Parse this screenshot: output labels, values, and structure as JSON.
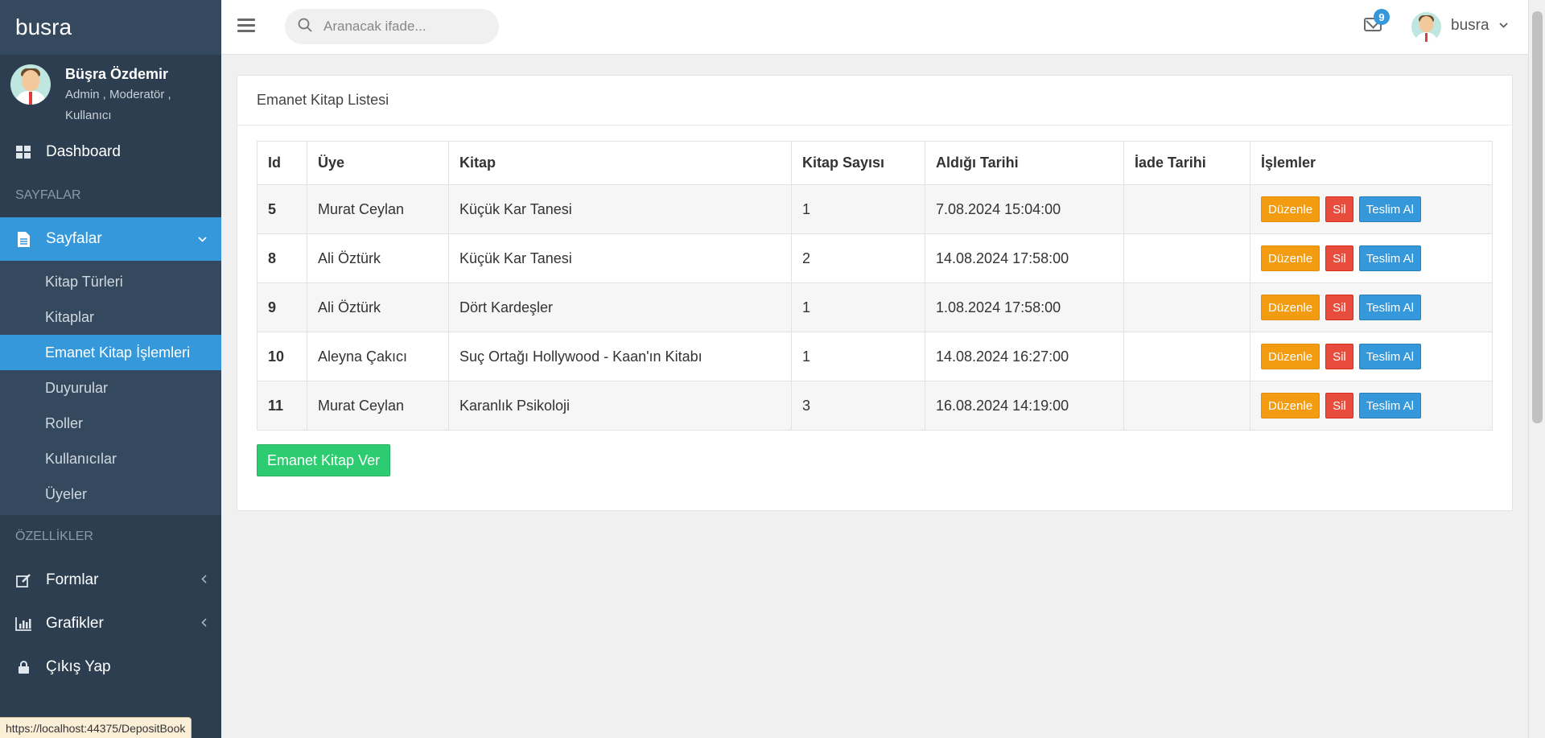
{
  "brand": "busra",
  "user": {
    "name": "Büşra Özdemir",
    "roles": "Admin , Moderatör , Kullanıcı"
  },
  "nav": {
    "dashboard": "Dashboard",
    "header_pages": "SAYFALAR",
    "pages": "Sayfalar",
    "sub_items": [
      "Kitap Türleri",
      "Kitaplar",
      "Emanet Kitap İşlemleri",
      "Duyurular",
      "Roller",
      "Kullanıcılar",
      "Üyeler"
    ],
    "header_features": "ÖZELLİKLER",
    "forms": "Formlar",
    "charts": "Grafikler",
    "logout": "Çıkış Yap"
  },
  "topbar": {
    "search_placeholder": "Aranacak ifade...",
    "mail_count": "9",
    "username": "busra"
  },
  "card": {
    "title": "Emanet Kitap Listesi"
  },
  "table": {
    "headers": [
      "Id",
      "Üye",
      "Kitap",
      "Kitap Sayısı",
      "Aldığı Tarihi",
      "İade Tarihi",
      "İşlemler"
    ],
    "rows": [
      {
        "id": "5",
        "member": "Murat Ceylan",
        "book": "Küçük Kar Tanesi",
        "count": "1",
        "date": "7.08.2024 15:04:00",
        "return": ""
      },
      {
        "id": "8",
        "member": "Ali Öztürk",
        "book": "Küçük Kar Tanesi",
        "count": "2",
        "date": "14.08.2024 17:58:00",
        "return": ""
      },
      {
        "id": "9",
        "member": "Ali Öztürk",
        "book": "Dört Kardeşler",
        "count": "1",
        "date": "1.08.2024 17:58:00",
        "return": ""
      },
      {
        "id": "10",
        "member": "Aleyna Çakıcı",
        "book": "Suç Ortağı Hollywood - Kaan'ın Kitabı",
        "count": "1",
        "date": "14.08.2024 16:27:00",
        "return": ""
      },
      {
        "id": "11",
        "member": "Murat Ceylan",
        "book": "Karanlık Psikoloji",
        "count": "3",
        "date": "16.08.2024 14:19:00",
        "return": ""
      }
    ],
    "actions": {
      "edit": "Düzenle",
      "delete": "Sil",
      "return": "Teslim Al"
    }
  },
  "add_button": "Emanet Kitap Ver",
  "status_url": "https://localhost:44375/DepositBook",
  "colors": {
    "sidebar": "#2c3e50",
    "active": "#3498db",
    "edit": "#f39c12",
    "delete": "#e74c3c",
    "add": "#2ecc71"
  }
}
